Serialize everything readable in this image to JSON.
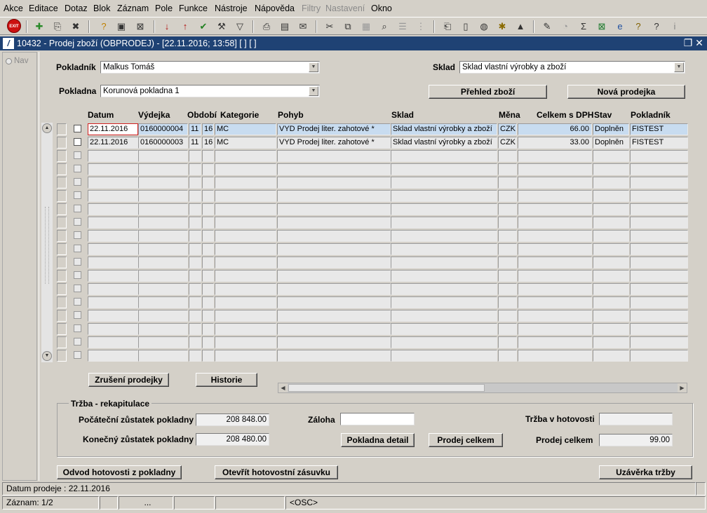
{
  "menu": {
    "items": [
      "Akce",
      "Editace",
      "Dotaz",
      "Blok",
      "Záznam",
      "Pole",
      "Funkce",
      "Nástroje",
      "Nápověda",
      "Filtry",
      "Nastavení",
      "Okno"
    ]
  },
  "toolbar": {
    "exit_label": "EXIT"
  },
  "window": {
    "title": "10432 - Prodej zboží (OBPRODEJ) - [22.11.2016; 13:58]  [ ]  [ ]"
  },
  "nav": {
    "label": "Nav"
  },
  "form": {
    "pokladnik_label": "Pokladník",
    "pokladnik_value": "Malkus Tomáš",
    "sklad_label": "Sklad",
    "sklad_value": "Sklad vlastní výrobky a zboží",
    "pokladna_label": "Pokladna",
    "pokladna_value": "Korunová pokladna 1",
    "prehled_button": "Přehled zboží",
    "nova_button": "Nová prodejka"
  },
  "grid": {
    "columns": [
      "Datum",
      "Výdejka",
      "Období",
      "Kategorie",
      "Pohyb",
      "Sklad",
      "Měna",
      "Celkem s DPH",
      "Stav",
      "Pokladník"
    ],
    "rows": [
      {
        "datum": "22.11.2016",
        "vydejka": "0160000004",
        "obd1": "11",
        "obd2": "16",
        "kategorie": "MC",
        "pohyb": "VYD Prodej liter. zahotové *",
        "sklad": "Sklad vlastní výrobky a zboží",
        "mena": "CZK",
        "celkem": "66.00",
        "stav": "Doplněn",
        "pokladnik": "FISTEST"
      },
      {
        "datum": "22.11.2016",
        "vydejka": "0160000003",
        "obd1": "11",
        "obd2": "16",
        "kategorie": "MC",
        "pohyb": "VYD Prodej liter. zahotové *",
        "sklad": "Sklad vlastní výrobky a zboží",
        "mena": "CZK",
        "celkem": "33.00",
        "stav": "Doplněn",
        "pokladnik": "FISTEST"
      }
    ],
    "empty_rows": 16
  },
  "actions": {
    "zruseni_button": "Zrušení prodejky",
    "historie_button": "Historie"
  },
  "recap": {
    "group_label": "Tržba - rekapitulace",
    "pocatecni_label": "Počáteční zůstatek pokladny",
    "pocatecni_value": "208 848.00",
    "konecny_label": "Konečný zůstatek pokladny",
    "konecny_value": "208 480.00",
    "zaloha_label": "Záloha",
    "zaloha_value": "",
    "trzba_label": "Tržba v hotovosti",
    "trzba_value": "",
    "pokladna_detail_button": "Pokladna detail",
    "prodej_celkem_button": "Prodej celkem",
    "prodej_celkem_label": "Prodej celkem",
    "prodej_celkem_value": "99.00"
  },
  "bottom": {
    "odvod_button": "Odvod hotovosti z pokladny",
    "otevrit_button": "Otevřít hotovostní zásuvku",
    "uzaverka_button": "Uzávěrka tržby"
  },
  "status": {
    "line1": "Datum prodeje : 22.11.2016",
    "zaznam": "Záznam: 1/2",
    "dots": "...",
    "mode": "<OSC>"
  }
}
